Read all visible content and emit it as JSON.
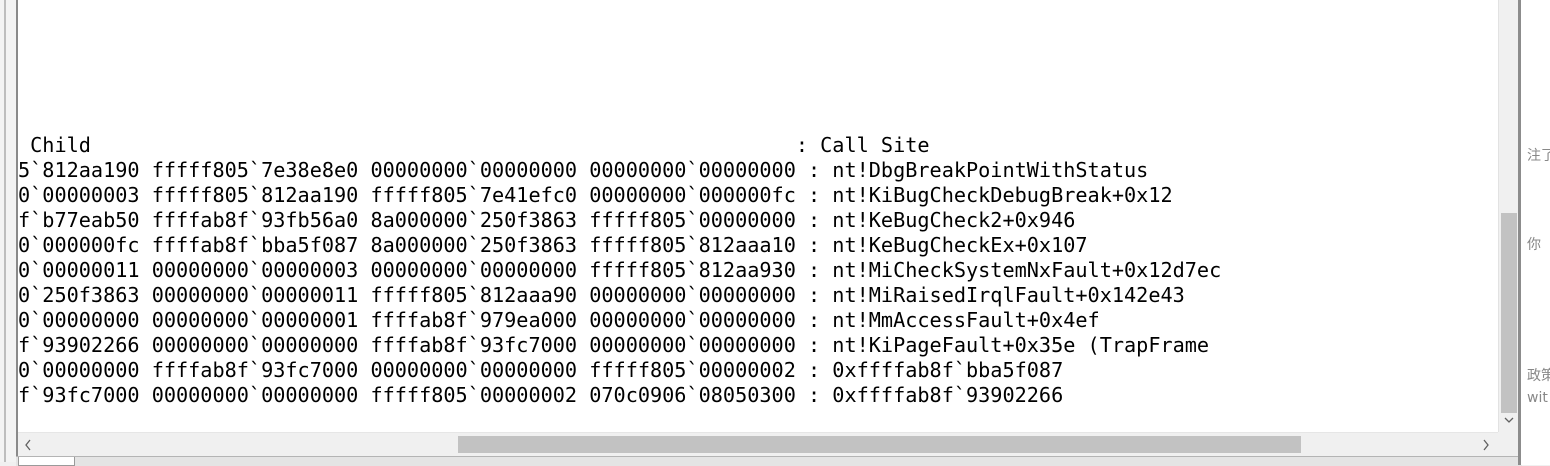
{
  "debugger_output": {
    "lines": [
      " Child                                                          : Call Site",
      "5`812aa190 fffff805`7e38e8e0 00000000`00000000 00000000`00000000 : nt!DbgBreakPointWithStatus",
      "0`00000003 fffff805`812aa190 fffff805`7e41efc0 00000000`000000fc : nt!KiBugCheckDebugBreak+0x12",
      "f`b77eab50 ffffab8f`93fb56a0 8a000000`250f3863 fffff805`00000000 : nt!KeBugCheck2+0x946",
      "0`000000fc ffffab8f`bba5f087 8a000000`250f3863 fffff805`812aaa10 : nt!KeBugCheckEx+0x107",
      "0`00000011 00000000`00000003 00000000`00000000 fffff805`812aa930 : nt!MiCheckSystemNxFault+0x12d7ec",
      "0`250f3863 00000000`00000011 fffff805`812aaa90 00000000`00000000 : nt!MiRaisedIrqlFault+0x142e43",
      "0`00000000 00000000`00000001 ffffab8f`979ea000 00000000`00000000 : nt!MmAccessFault+0x4ef",
      "f`93902266 00000000`00000000 ffffab8f`93fc7000 00000000`00000000 : nt!KiPageFault+0x35e (TrapFrame",
      "0`00000000 ffffab8f`93fc7000 00000000`00000000 fffff805`00000002 : 0xffffab8f`bba5f087",
      "f`93fc7000 00000000`00000000 fffff805`00000002 070c0906`08050300 : 0xffffab8f`93902266"
    ]
  },
  "background_window": {
    "fragments": [
      "注了",
      "你",
      "政策",
      "wit"
    ]
  },
  "icons": {
    "scroll_left": "chevron-left-icon",
    "scroll_right": "chevron-right-icon",
    "scroll_down": "chevron-down-icon"
  }
}
